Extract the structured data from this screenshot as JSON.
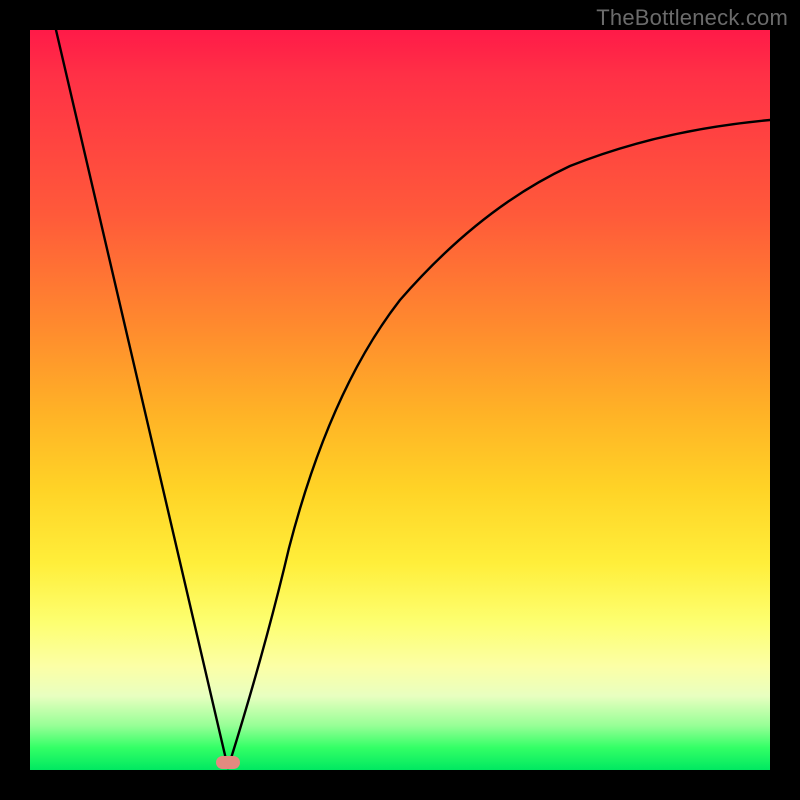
{
  "watermark": "TheBottleneck.com",
  "marker": {
    "x_fraction": 0.268,
    "color": "#e38a80"
  },
  "chart_data": {
    "type": "line",
    "title": "",
    "xlabel": "",
    "ylabel": "",
    "xlim": [
      0,
      1
    ],
    "ylim": [
      0,
      1
    ],
    "series": [
      {
        "name": "left-branch",
        "x": [
          0.035,
          0.268
        ],
        "y": [
          1.0,
          0.0
        ],
        "note": "descending straight line from near top-left down to minimum"
      },
      {
        "name": "right-branch",
        "x": [
          0.268,
          0.35,
          0.45,
          0.55,
          0.65,
          0.75,
          0.85,
          0.95,
          1.0
        ],
        "y": [
          0.0,
          0.3,
          0.52,
          0.65,
          0.74,
          0.8,
          0.84,
          0.87,
          0.88
        ],
        "note": "concave-up rising curve approaching ~0.88 at right edge"
      }
    ],
    "minimum": {
      "x": 0.268,
      "y": 0.0
    },
    "background_gradient_meaning": "red=high bottleneck, green=low bottleneck"
  }
}
